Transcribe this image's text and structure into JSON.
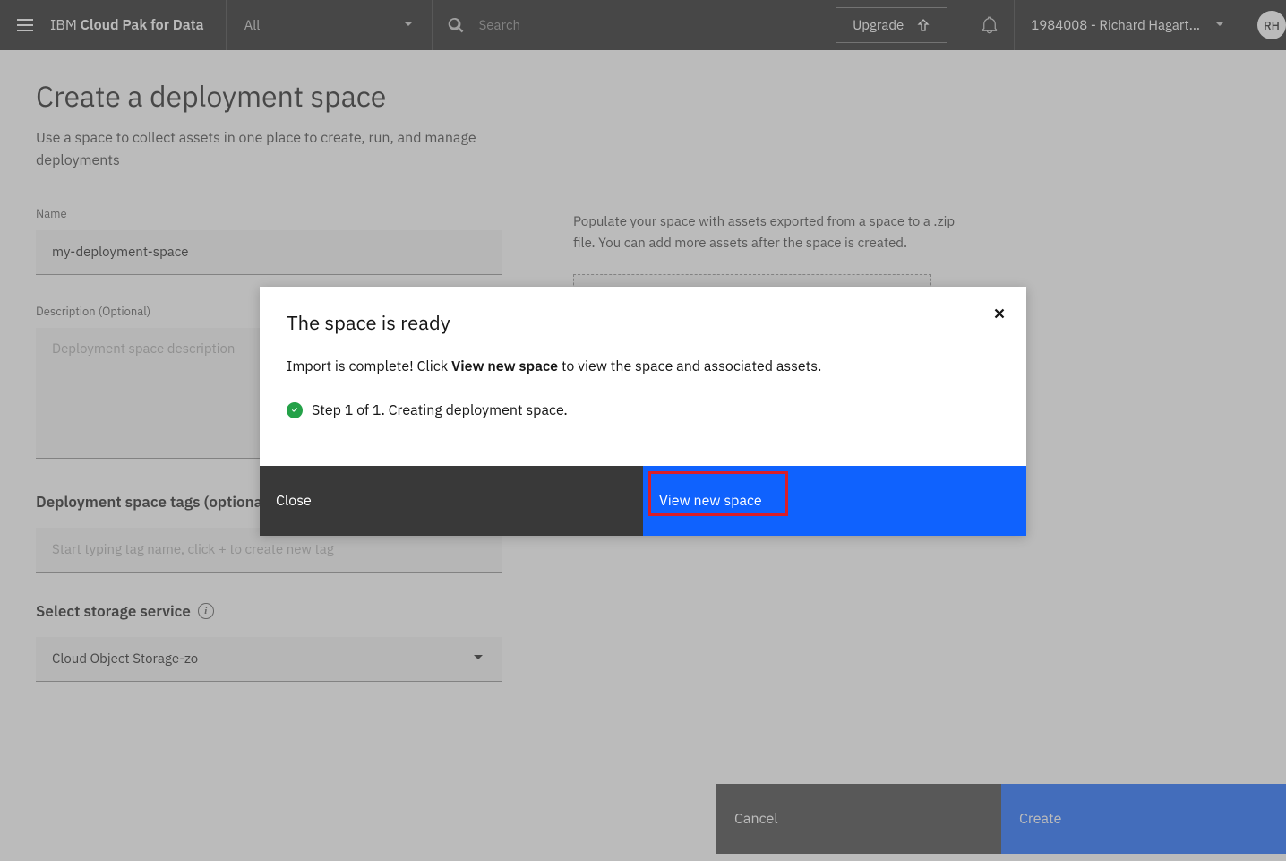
{
  "header": {
    "brand_prefix": "IBM ",
    "brand_bold": "Cloud Pak for Data",
    "scope_selector": "All",
    "search_placeholder": "Search",
    "upgrade_label": "Upgrade",
    "account_label": "1984008 - Richard Hagart...",
    "avatar_initials": "RH"
  },
  "page": {
    "title": "Create a deployment space",
    "subtitle": "Use a space to collect assets in one place to create, run, and manage deployments"
  },
  "form": {
    "name_label": "Name",
    "name_value": "my-deployment-space",
    "description_label": "Description (Optional)",
    "description_placeholder": "Deployment space description",
    "tags_label": "Deployment space tags (optional)",
    "tags_placeholder": "Start typing tag name, click + to create new tag",
    "storage_label": "Select storage service",
    "storage_value": "Cloud Object Storage-zo"
  },
  "right_panel": {
    "description": "Populate your space with assets exported from a space to a .zip file. You can add more assets after the space is created."
  },
  "footer": {
    "cancel": "Cancel",
    "create": "Create"
  },
  "modal": {
    "title": "The space is ready",
    "text_before": "Import is complete! Click ",
    "text_bold": "View new space",
    "text_after": " to view the space and associated assets.",
    "step_text": "Step 1 of 1. Creating deployment space.",
    "close_label": "Close",
    "view_label": "View new space"
  }
}
